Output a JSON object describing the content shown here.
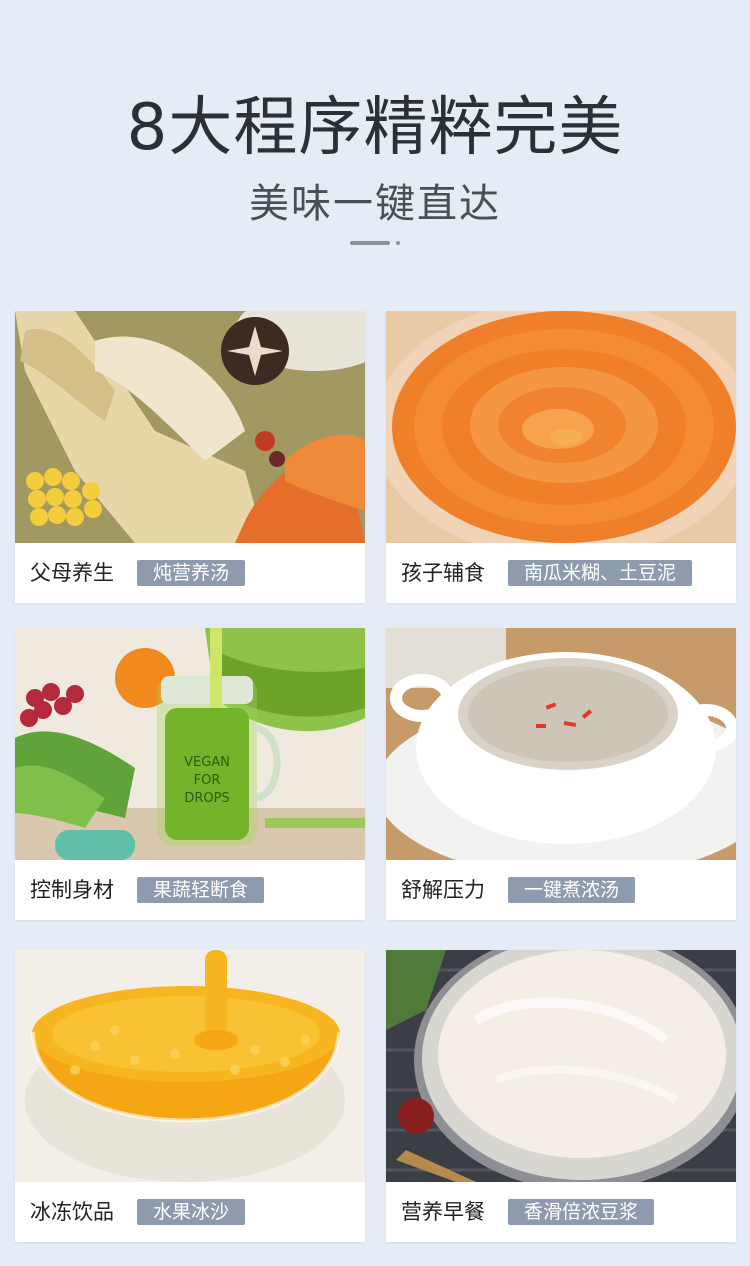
{
  "header": {
    "title": "8大程序精粹完美",
    "subtitle": "美味一键直达"
  },
  "cards": [
    {
      "label": "父母养生",
      "tag": "炖营养汤",
      "image": "chicken-soup-photo"
    },
    {
      "label": "孩子辅食",
      "tag": "南瓜米糊、土豆泥",
      "image": "pumpkin-puree-photo"
    },
    {
      "label": "控制身材",
      "tag": "果蔬轻断食",
      "image": "green-juice-photo",
      "jar_text": "VEGAN FOR DROPS"
    },
    {
      "label": "舒解压力",
      "tag": "一键煮浓汤",
      "image": "cream-soup-photo"
    },
    {
      "label": "冰冻饮品",
      "tag": "水果冰沙",
      "image": "mango-smoothie-photo"
    },
    {
      "label": "营养早餐",
      "tag": "香滑倍浓豆浆",
      "image": "soy-milk-photo"
    }
  ],
  "colors": {
    "background": "#e6ecf5",
    "tag_background": "#8e9aad",
    "title": "#2b3036"
  }
}
